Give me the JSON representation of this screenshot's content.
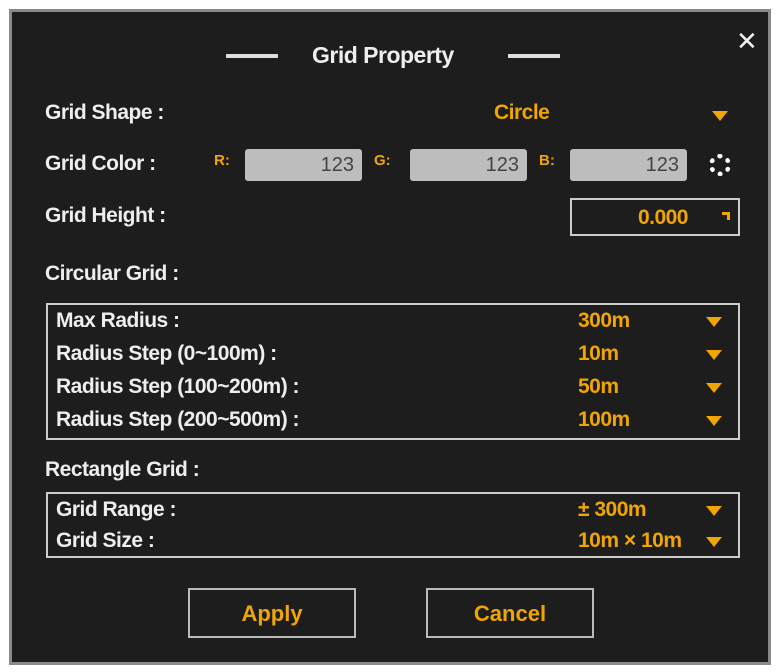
{
  "title": "Grid Property",
  "close": "✕",
  "grid_shape": {
    "label": "Grid Shape :",
    "value": "Circle"
  },
  "grid_color": {
    "label": "Grid Color :",
    "r_label": "R:",
    "r": "123",
    "g_label": "G:",
    "g": "123",
    "b_label": "B:",
    "b": "123"
  },
  "grid_height": {
    "label": "Grid Height :",
    "value": "0.000"
  },
  "circular": {
    "label": "Circular Grid :",
    "rows": [
      {
        "label": "Max Radius :",
        "value": "300m"
      },
      {
        "label": "Radius Step (0~100m) :",
        "value": "10m"
      },
      {
        "label": "Radius Step (100~200m) :",
        "value": "50m"
      },
      {
        "label": "Radius Step (200~500m) :",
        "value": "100m"
      }
    ]
  },
  "rectangle": {
    "label": "Rectangle Grid :",
    "rows": [
      {
        "label": "Grid Range :",
        "value": "± 300m"
      },
      {
        "label": "Grid Size :",
        "value": "10m × 10m"
      }
    ]
  },
  "buttons": {
    "apply": "Apply",
    "cancel": "Cancel"
  }
}
